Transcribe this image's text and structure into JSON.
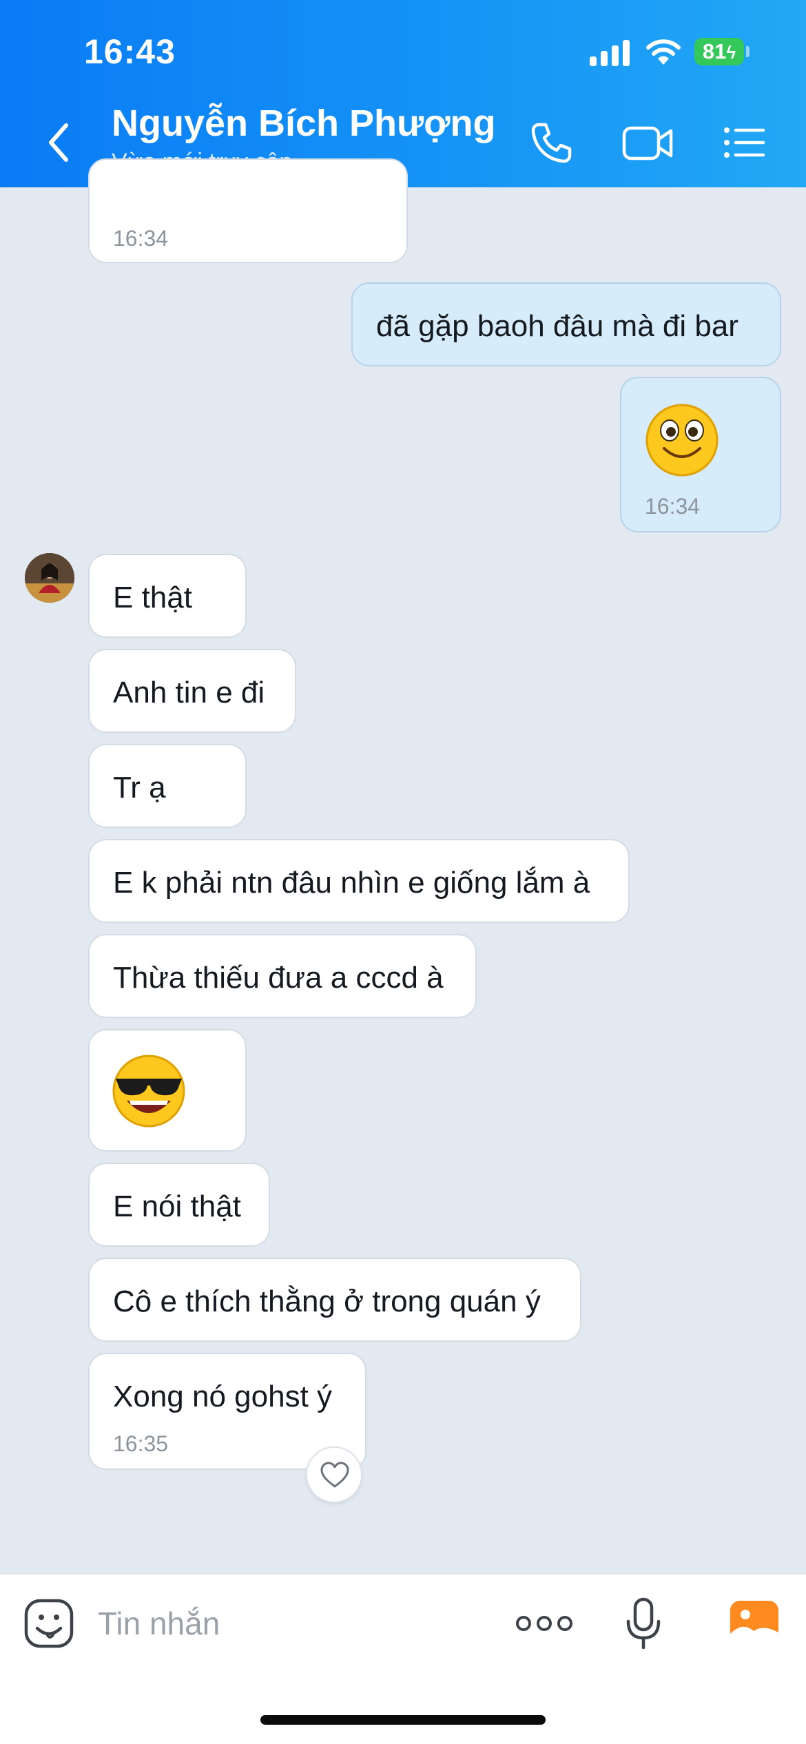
{
  "status_bar": {
    "time": "16:43",
    "battery": "81"
  },
  "header": {
    "contact_name": "Nguyễn Bích Phượng",
    "contact_status": "Vừa mới truy cập",
    "icons": [
      "back-chevron-icon",
      "phone-icon",
      "video-call-icon",
      "menu-list-icon"
    ]
  },
  "messages": [
    {
      "direction": "in",
      "text": "",
      "time": "16:34",
      "partial": true
    },
    {
      "direction": "out",
      "text": "đã gặp baoh đâu mà đi bar"
    },
    {
      "direction": "out",
      "emoji": "smiling-emoji",
      "time": "16:34"
    },
    {
      "direction": "in",
      "text": "E thật"
    },
    {
      "direction": "in",
      "text": "Anh tin e đi"
    },
    {
      "direction": "in",
      "text": "Tr ạ"
    },
    {
      "direction": "in",
      "text": "E k phải ntn đâu nhìn e giống lắm à"
    },
    {
      "direction": "in",
      "text": "Thừa thiếu đưa a cccd à"
    },
    {
      "direction": "in",
      "emoji": "sunglasses-emoji"
    },
    {
      "direction": "in",
      "text": "E nói thật"
    },
    {
      "direction": "in",
      "text": "Cô e thích thằng ở trong quán ý"
    },
    {
      "direction": "in",
      "text": "Xong nó gohst ý",
      "time": "16:35"
    }
  ],
  "composer": {
    "placeholder": "Tin nhắn",
    "icons": [
      "sticker-icon",
      "more-dots-icon",
      "microphone-icon",
      "gallery-icon"
    ]
  },
  "colors": {
    "header_start": "#0a7bf5",
    "header_end": "#22a8f5",
    "chat_bg": "#e2e9f1",
    "outgoing_bubble": "#d6ecfb",
    "incoming_bubble": "#ffffff",
    "battery": "#34c759"
  }
}
